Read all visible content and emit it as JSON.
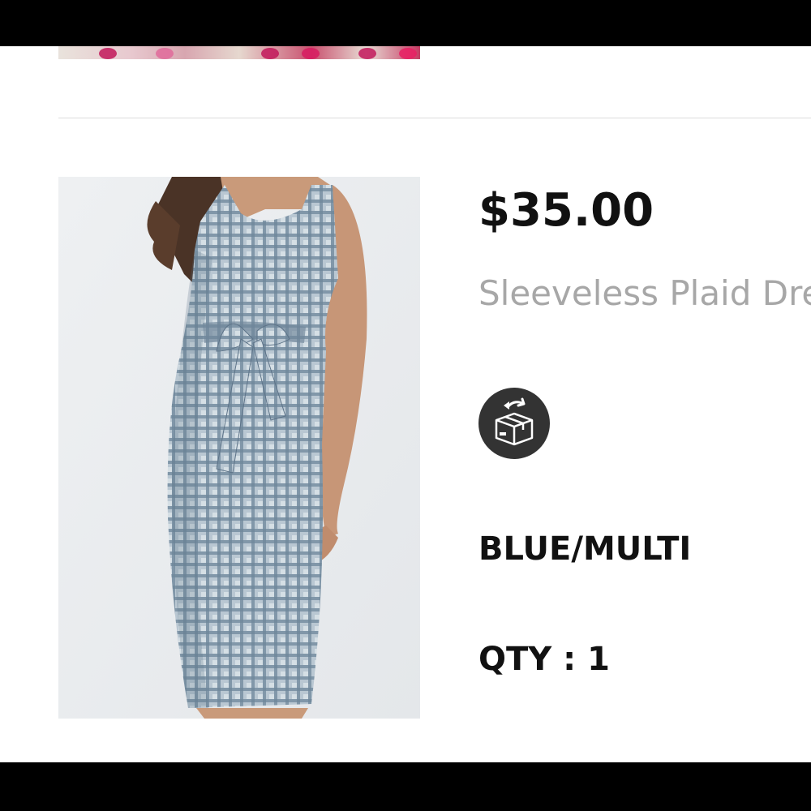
{
  "product": {
    "price": "$35.00",
    "title": "Sleeveless Plaid Dress",
    "return_icon": "return-box-icon",
    "color": "BLUE/MULTI",
    "quantity": "QTY : 1"
  },
  "colors": {
    "background": "#ffffff",
    "price_text": "#111111",
    "title_text": "#a7a7a7",
    "divider": "#dcdcdc",
    "icon_badge": "#333333",
    "dress_plaid": "#7f96a8"
  }
}
